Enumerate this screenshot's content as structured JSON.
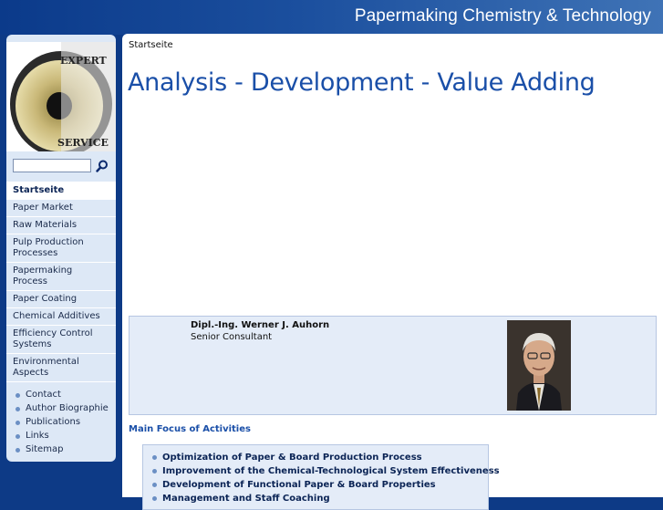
{
  "header": {
    "site_title": "Papermaking Chemistry & Technology"
  },
  "logo": {
    "text_top": "EXPERT",
    "text_bottom": "SERVICE"
  },
  "search": {
    "placeholder": ""
  },
  "nav": {
    "items": [
      {
        "label": "Startseite",
        "active": true
      },
      {
        "label": "Paper Market"
      },
      {
        "label": "Raw Materials"
      },
      {
        "label": "Pulp Production Processes"
      },
      {
        "label": "Papermaking Process"
      },
      {
        "label": "Paper Coating"
      },
      {
        "label": "Chemical Additives"
      },
      {
        "label": "Efficiency Control Systems"
      },
      {
        "label": "Environmental Aspects"
      }
    ],
    "links": [
      {
        "label": "Contact"
      },
      {
        "label": "Author Biographie"
      },
      {
        "label": "Publications"
      },
      {
        "label": "Links"
      },
      {
        "label": "Sitemap"
      }
    ]
  },
  "main": {
    "breadcrumb": "Startseite",
    "headline": "Analysis - Development - Value Adding",
    "profile": {
      "name": "Dipl.-Ing. Werner J. Auhorn",
      "role": "Senior Consultant"
    },
    "focus_heading": "Main Focus of Activities",
    "focus_items": [
      "Optimization of Paper & Board Production Process",
      "Improvement of the Chemical-Technological System Effectiveness",
      "Development of Functional Paper & Board Properties",
      "Management and Staff Coaching"
    ]
  },
  "colors": {
    "brand_blue": "#0d3a86",
    "headline_blue": "#1a4fa8",
    "panel_bg": "#e4ecf8",
    "nav_bg": "#dde8f6"
  }
}
